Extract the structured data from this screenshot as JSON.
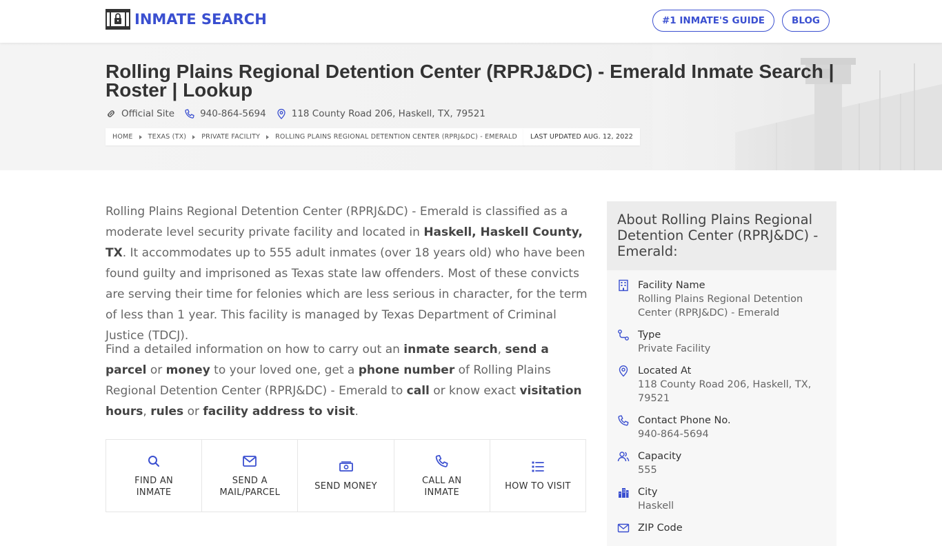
{
  "brand": {
    "name": "INMATE SEARCH",
    "accent": "#3a4fd0"
  },
  "nav": {
    "guide": "#1 INMATE'S GUIDE",
    "blog": "BLOG"
  },
  "hero": {
    "title": "Rolling Plains Regional Detention Center (RPRJ&DC) - Emerald Inmate Search | Roster | Lookup",
    "official_site": "Official Site",
    "phone": "940-864-5694",
    "address": "118 County Road 206, Haskell, TX, 79521",
    "breadcrumbs": [
      "HOME",
      "TEXAS (TX)",
      "PRIVATE FACILITY",
      "ROLLING PLAINS REGIONAL DETENTION CENTER (RPRJ&DC) - EMERALD"
    ],
    "last_updated": "LAST UPDATED AUG. 12, 2022"
  },
  "intro": {
    "p1_a": "Rolling Plains Regional Detention Center (RPRJ&DC) - Emerald is classified as a moderate level security private facility and located in ",
    "p1_b": "Haskell, Haskell County, TX",
    "p1_c": ". It accommodates up to 555 adult inmates (over 18 years old) who have been found guilty and imprisoned as Texas state law offenders. Most of these convicts are serving their time for felonies which are less serious in character, for the term of less than 1 year. This facility is managed by Texas Department of Criminal Justice (TDCJ).",
    "p2_a": "Find a detailed information on how to carry out an ",
    "p2_b": "inmate search",
    "p2_c": ", ",
    "p2_d": "send a parcel",
    "p2_e": " or ",
    "p2_f": "money",
    "p2_g": " to your loved one, get a ",
    "p2_h": "phone number",
    "p2_i": " of Rolling Plains Regional Detention Center (RPRJ&DC) - Emerald to ",
    "p2_j": "call",
    "p2_k": " or know exact ",
    "p2_l": "visitation hours",
    "p2_m": ", ",
    "p2_n": "rules",
    "p2_o": " or ",
    "p2_p": "facility address to visit",
    "p2_q": "."
  },
  "actions": [
    {
      "line1": "FIND AN",
      "line2": "INMATE",
      "icon": "search-icon"
    },
    {
      "line1": "SEND A",
      "line2": "MAIL/PARCEL",
      "icon": "mail-icon"
    },
    {
      "line1": "SEND MONEY",
      "line2": "",
      "icon": "money-icon"
    },
    {
      "line1": "CALL AN",
      "line2": "INMATE",
      "icon": "phone-icon"
    },
    {
      "line1": "HOW TO VISIT",
      "line2": "",
      "icon": "list-icon"
    }
  ],
  "about": {
    "heading": "About Rolling Plains Regional Detention Center (RPRJ&DC) - Emerald:",
    "facts": [
      {
        "label": "Facility Name",
        "value": "Rolling Plains Regional Detention Center (RPRJ&DC) - Emerald"
      },
      {
        "label": "Type",
        "value": "Private Facility"
      },
      {
        "label": "Located At",
        "value": "118 County Road 206, Haskell, TX, 79521"
      },
      {
        "label": "Contact Phone No.",
        "value": "940-864-5694"
      },
      {
        "label": "Capacity",
        "value": "555"
      },
      {
        "label": "City",
        "value": "Haskell"
      },
      {
        "label": "ZIP Code",
        "value": ""
      }
    ]
  }
}
